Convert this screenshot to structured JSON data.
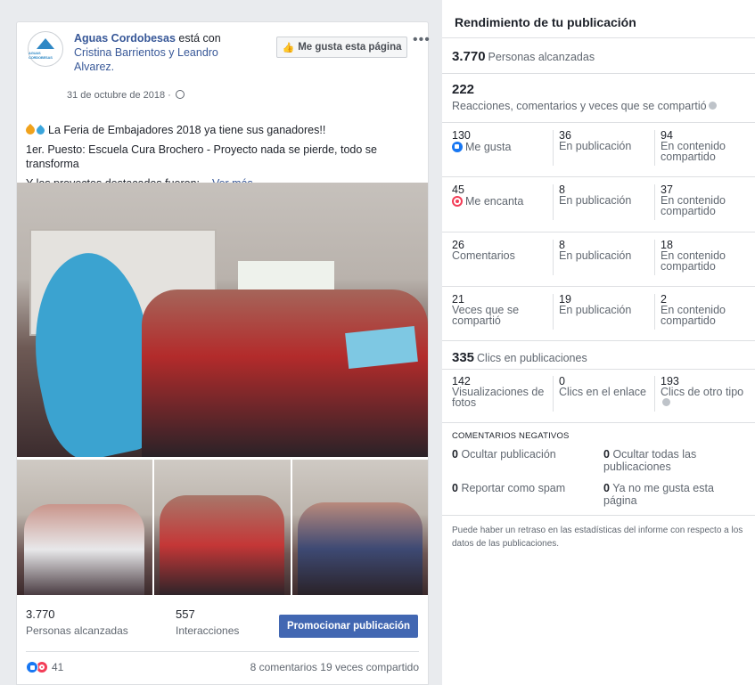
{
  "post": {
    "page_name": "Aguas Cordobesas",
    "with_text": "está con",
    "tagged_people": "Cristina Barrientos y Leandro Alvarez.",
    "logo_text": "AGUAS CORDOBESAS",
    "date": "31 de octubre de 2018 ·",
    "like_page_button": "Me gusta esta página",
    "more_icon": "more-options-icon",
    "line1": "La Feria de Embajadores 2018 ya tiene sus ganadores!!",
    "line2": "1er. Puesto: Escuela Cura Brochero - Proyecto nada se pierde, todo se transforma",
    "line3": "Y los proyectos destacados fueron:...",
    "see_more": "Ver más",
    "reach_value": "3.770",
    "reach_label": "Personas alcanzadas",
    "interactions_value": "557",
    "interactions_label": "Interacciones",
    "promote_button": "Promocionar publicación",
    "reactions_count": "41",
    "comments_shares": "8 comentarios  19 veces compartido"
  },
  "insights": {
    "title": "Rendimiento de tu publicación",
    "reach_value": "3.770",
    "reach_label": "Personas alcanzadas",
    "engagement_value": "222",
    "engagement_label": "Reacciones, comentarios y veces que se compartió",
    "rows": [
      {
        "total": "130",
        "label": "Me gusta",
        "icon": "like-icon",
        "on_post": "36",
        "on_post_label": "En publicación",
        "shared": "94",
        "shared_label": "En contenido compartido"
      },
      {
        "total": "45",
        "label": "Me encanta",
        "icon": "love-icon",
        "on_post": "8",
        "on_post_label": "En publicación",
        "shared": "37",
        "shared_label": "En contenido compartido"
      },
      {
        "total": "26",
        "label": "Comentarios",
        "on_post": "8",
        "on_post_label": "En publicación",
        "shared": "18",
        "shared_label": "En contenido compartido"
      },
      {
        "total": "21",
        "label": "Veces que se compartió",
        "on_post": "19",
        "on_post_label": "En publicación",
        "shared": "2",
        "shared_label": "En contenido compartido"
      }
    ],
    "clicks_value": "335",
    "clicks_label": "Clics en publicaciones",
    "clicks": [
      {
        "value": "142",
        "label": "Visualizaciones de fotos"
      },
      {
        "value": "0",
        "label": "Clics en el enlace"
      },
      {
        "value": "193",
        "label": "Clics de otro tipo"
      }
    ],
    "negative_title": "COMENTARIOS NEGATIVOS",
    "negative": [
      {
        "value": "0",
        "label": "Ocultar publicación"
      },
      {
        "value": "0",
        "label": "Ocultar todas las publicaciones"
      },
      {
        "value": "0",
        "label": "Reportar como spam"
      },
      {
        "value": "0",
        "label": "Ya no me gusta esta página"
      }
    ],
    "footnote": "Puede haber un retraso en las estadísticas del informe con respecto a los datos de las publicaciones."
  },
  "colors": {
    "brand_blue": "#4267b2",
    "link": "#385898",
    "like": "#1877f2",
    "love": "#f33e58"
  }
}
